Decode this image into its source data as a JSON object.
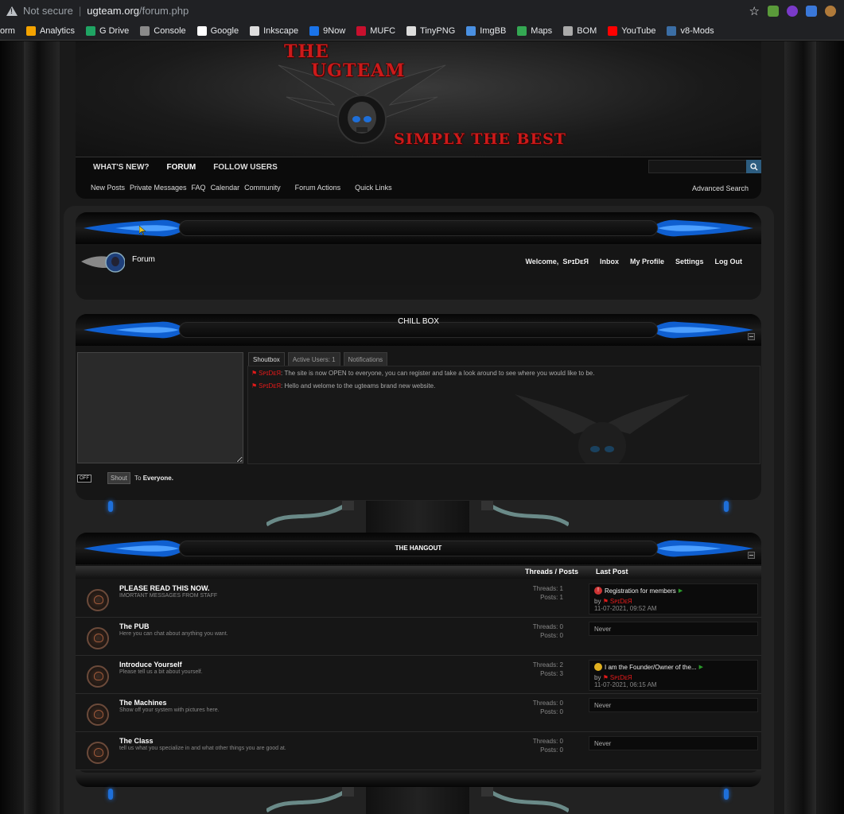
{
  "browser": {
    "security": "Not secure",
    "host": "ugteam.org",
    "path": "/forum.php",
    "bookmarks": [
      {
        "label": "orm",
        "color": "#202124"
      },
      {
        "label": "Analytics",
        "color": "#f4a300"
      },
      {
        "label": "G Drive",
        "color": "#1fa463"
      },
      {
        "label": "Console",
        "color": "#8a8a8a"
      },
      {
        "label": "Google",
        "color": "#ffffff"
      },
      {
        "label": "Inkscape",
        "color": "#dddddd"
      },
      {
        "label": "9Now",
        "color": "#1a73e8"
      },
      {
        "label": "MUFC",
        "color": "#c8102e"
      },
      {
        "label": "TinyPNG",
        "color": "#dddddd"
      },
      {
        "label": "ImgBB",
        "color": "#4a90e2"
      },
      {
        "label": "Maps",
        "color": "#34a853"
      },
      {
        "label": "BOM",
        "color": "#aaaaaa"
      },
      {
        "label": "YouTube",
        "color": "#ff0000"
      },
      {
        "label": "v8-Mods",
        "color": "#3b6ea5"
      }
    ]
  },
  "header": {
    "brand_line1": "THE",
    "brand_line2": "UGTEAM",
    "tagline": "SIMPLY THE BEST"
  },
  "nav": {
    "top": [
      "WHAT'S NEW?",
      "FORUM",
      "FOLLOW USERS"
    ],
    "active": "FORUM",
    "sub": [
      "New Posts",
      "Private Messages",
      "FAQ",
      "Calendar",
      "Community",
      "Forum Actions",
      "Quick Links"
    ],
    "advanced_search": "Advanced Search"
  },
  "forum_block": {
    "label": "Forum",
    "welcome": "Welcome,",
    "username": "SᴘɪDᴇЯ",
    "links": [
      "Inbox",
      "My Profile",
      "Settings",
      "Log Out"
    ]
  },
  "chillbox": {
    "title": "CHILL BOX",
    "tabs": [
      "Shoutbox",
      "Active Users: 1",
      "Notifications"
    ],
    "messages": [
      {
        "user": "SᴘɪDᴇЯ",
        "text": ": The site is now OPEN to everyone, you can register and take a look around to see where you would like to be."
      },
      {
        "user": "SᴘɪDᴇЯ",
        "text": ": Hello and welome to the ugteams brand new website."
      }
    ],
    "off_label": "OFF",
    "shout_label": "Shout",
    "to_text": "To",
    "to_target": "Everyone."
  },
  "hangout": {
    "title": "THE HANGOUT",
    "col_threads": "Threads / Posts",
    "col_last": "Last Post",
    "forums": [
      {
        "title": "PLEASE READ THIS NOW.",
        "desc": "IMORTANT MESSAGES FROM STAFF",
        "threads": "Threads: 1",
        "posts": "Posts: 1",
        "last": {
          "icon": "red",
          "title": "Registration for members",
          "by": "by",
          "user": "SᴘɪDᴇЯ",
          "date": "11-07-2021, 09:52 AM"
        }
      },
      {
        "title": "The PUB",
        "desc": "Here you can chat about anything you want.",
        "threads": "Threads: 0",
        "posts": "Posts: 0",
        "last": {
          "never": "Never"
        }
      },
      {
        "title": "Introduce Yourself",
        "desc": "Please tell us a bit about yourself.",
        "threads": "Threads: 2",
        "posts": "Posts: 3",
        "last": {
          "icon": "yellow",
          "title": "I am the Founder/Owner of the...",
          "by": "by",
          "user": "SᴘɪDᴇЯ",
          "date": "11-07-2021, 06:15 AM"
        }
      },
      {
        "title": "The Machines",
        "desc": "Show off your system with pictures here.",
        "threads": "Threads: 0",
        "posts": "Posts: 0",
        "last": {
          "never": "Never"
        }
      },
      {
        "title": "The Class",
        "desc": "tell us what you specialize in and what other things you are good at.",
        "threads": "Threads: 0",
        "posts": "Posts: 0",
        "last": {
          "never": "Never"
        }
      }
    ]
  },
  "colors": {
    "accent_blue": "#1e6fd9",
    "brand_red": "#cc1a1a",
    "user_red": "#e01a1a"
  }
}
